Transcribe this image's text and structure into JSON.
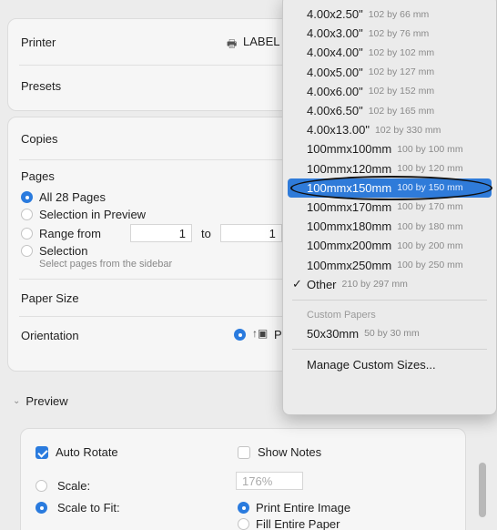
{
  "printer": {
    "label": "Printer",
    "value": "LABEL"
  },
  "presets": {
    "label": "Presets"
  },
  "copies": {
    "label": "Copies"
  },
  "pages": {
    "label": "Pages",
    "all": "All 28 Pages",
    "selection_preview": "Selection in Preview",
    "range_from": "Range from",
    "range_start": "1",
    "range_to": "to",
    "range_end": "1",
    "selection": "Selection",
    "selection_hint": "Select pages from the sidebar"
  },
  "paper_size": {
    "label": "Paper Size"
  },
  "orientation": {
    "label": "Orientation",
    "value": "P"
  },
  "preview_section": {
    "label": "Preview"
  },
  "preview": {
    "auto_rotate": "Auto Rotate",
    "show_notes": "Show Notes",
    "scale": "Scale:",
    "scale_value": "176%",
    "scale_to_fit": "Scale to Fit:",
    "print_entire_image": "Print Entire Image",
    "fill_entire_paper": "Fill Entire Paper"
  },
  "menu": {
    "items": [
      {
        "name": "4.00x2.50\"",
        "dim": "102 by 66 mm"
      },
      {
        "name": "4.00x3.00\"",
        "dim": "102 by 76 mm"
      },
      {
        "name": "4.00x4.00\"",
        "dim": "102 by 102 mm"
      },
      {
        "name": "4.00x5.00\"",
        "dim": "102 by 127 mm"
      },
      {
        "name": "4.00x6.00\"",
        "dim": "102 by 152 mm"
      },
      {
        "name": "4.00x6.50\"",
        "dim": "102 by 165 mm"
      },
      {
        "name": "4.00x13.00\"",
        "dim": "102 by 330 mm"
      },
      {
        "name": "100mmx100mm",
        "dim": "100 by 100 mm"
      },
      {
        "name": "100mmx120mm",
        "dim": "100 by 120 mm"
      },
      {
        "name": "100mmx150mm",
        "dim": "100 by 150 mm"
      },
      {
        "name": "100mmx170mm",
        "dim": "100 by 170 mm"
      },
      {
        "name": "100mmx180mm",
        "dim": "100 by 180 mm"
      },
      {
        "name": "100mmx200mm",
        "dim": "100 by 200 mm"
      },
      {
        "name": "100mmx250mm",
        "dim": "100 by 250 mm"
      },
      {
        "name": "Other",
        "dim": "210 by 297 mm"
      }
    ],
    "custom_heading": "Custom Papers",
    "custom_item": {
      "name": "50x30mm",
      "dim": "50 by 30 mm"
    },
    "manage": "Manage Custom Sizes...",
    "selected_index": 9,
    "checked_index": 14
  },
  "colors": {
    "accent": "#2f7bd9"
  }
}
